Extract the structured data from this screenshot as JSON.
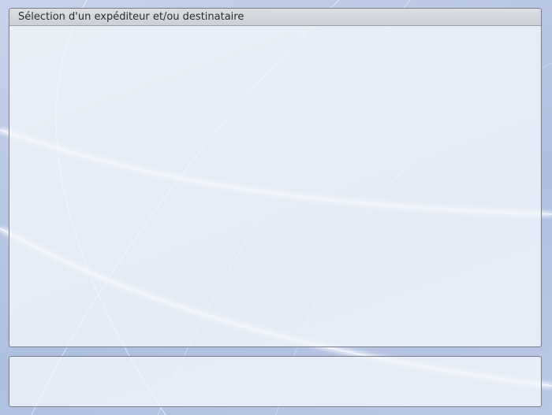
{
  "dialog": {
    "title": "Sélection d'un expéditeur et/ou destinataire"
  },
  "colors": {
    "background": "#b7c6e3",
    "panel": "#f4f7fb",
    "panel_border": "#7a7f88",
    "header": "#d3d6dc"
  }
}
